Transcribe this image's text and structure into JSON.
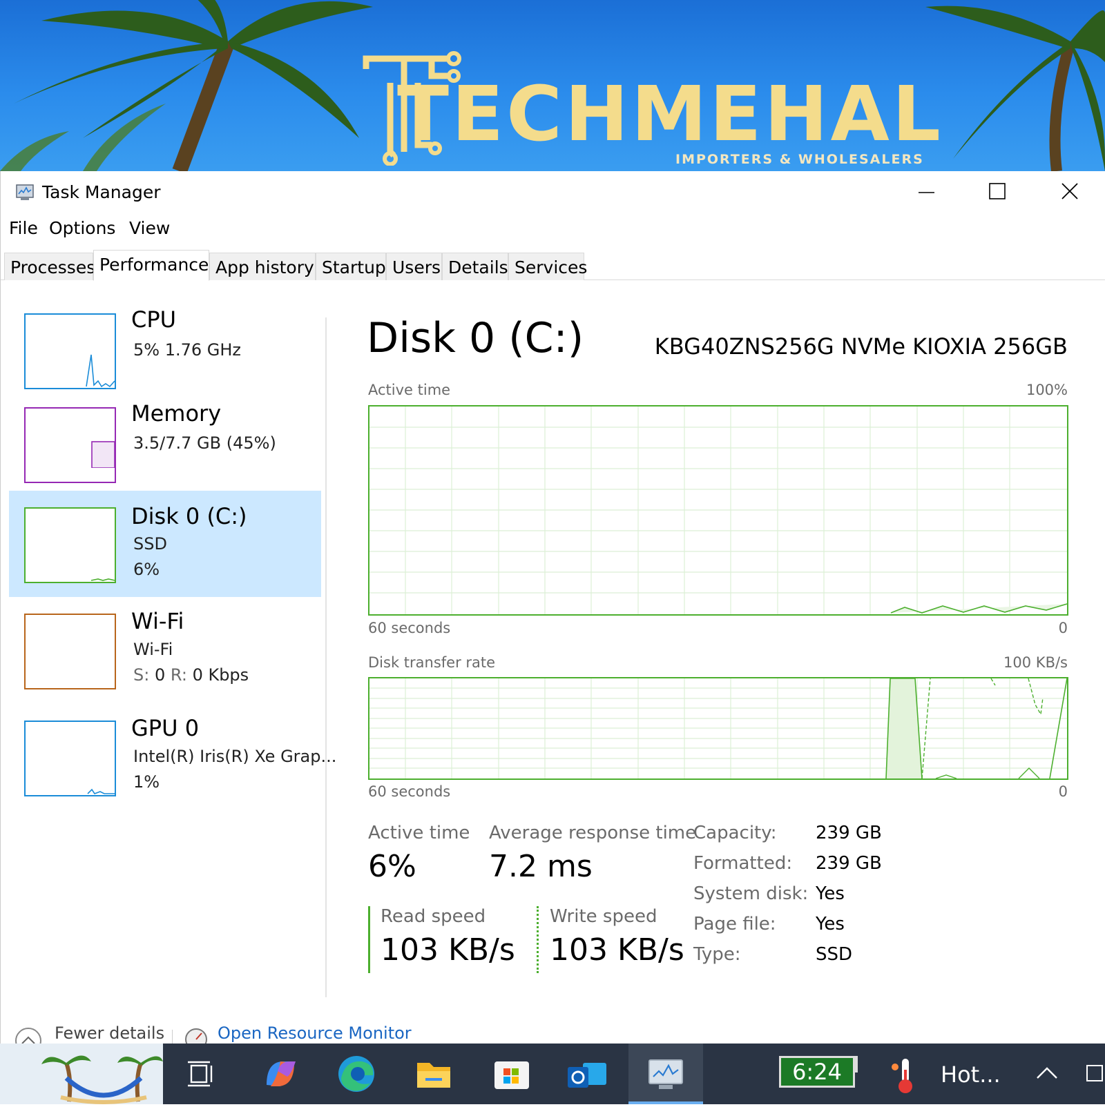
{
  "banner": {
    "logo_text": "TECHMEHAL",
    "logo_sub": "IMPORTERS & WHOLESALERS"
  },
  "window": {
    "title": "Task Manager",
    "menu": [
      "File",
      "Options",
      "View"
    ],
    "tabs": [
      "Processes",
      "Performance",
      "App history",
      "Startup",
      "Users",
      "Details",
      "Services"
    ],
    "active_tab": "Performance"
  },
  "sidebar": {
    "cpu": {
      "title": "CPU",
      "line1": "5%  1.76 GHz",
      "color": "#1a8cd8"
    },
    "memory": {
      "title": "Memory",
      "line1": "3.5/7.7 GB (45%)",
      "color": "#9528b4"
    },
    "disk": {
      "title": "Disk 0 (C:)",
      "line1": "SSD",
      "line2": "6%",
      "color": "#4caf2e"
    },
    "wifi": {
      "title": "Wi-Fi",
      "line1": "Wi-Fi",
      "send_label": "S:",
      "send_value": "0",
      "recv_label": "R:",
      "recv_value": "0 Kbps",
      "color": "#b8651b"
    },
    "gpu": {
      "title": "GPU 0",
      "line1": "Intel(R) Iris(R) Xe Grap...",
      "line2": "1%",
      "color": "#1a8cd8"
    }
  },
  "main": {
    "title": "Disk 0 (C:)",
    "model": "KBG40ZNS256G NVMe KIOXIA 256GB",
    "chart1": {
      "label": "Active time",
      "max": "100%",
      "xleft": "60 seconds",
      "xright": "0"
    },
    "chart2": {
      "label": "Disk transfer rate",
      "max": "100 KB/s",
      "xleft": "60 seconds",
      "xright": "0"
    },
    "stats": {
      "active_time_label": "Active time",
      "active_time_value": "6%",
      "avg_response_label": "Average response time",
      "avg_response_value": "7.2 ms",
      "read_label": "Read speed",
      "read_value": "103 KB/s",
      "write_label": "Write speed",
      "write_value": "103 KB/s"
    },
    "props": [
      {
        "label": "Capacity:",
        "value": "239 GB"
      },
      {
        "label": "Formatted:",
        "value": "239 GB"
      },
      {
        "label": "System disk:",
        "value": "Yes"
      },
      {
        "label": "Page file:",
        "value": "Yes"
      },
      {
        "label": "Type:",
        "value": "SSD"
      }
    ]
  },
  "footer": {
    "fewer_details": "Fewer details",
    "resource_monitor": "Open Resource Monitor"
  },
  "taskbar": {
    "clock": "6:24",
    "weather": "Hot..."
  },
  "colors": {
    "accent_green": "#4caf2e",
    "selected_bg": "#cce8ff",
    "taskbar_bg": "#2a3444"
  }
}
